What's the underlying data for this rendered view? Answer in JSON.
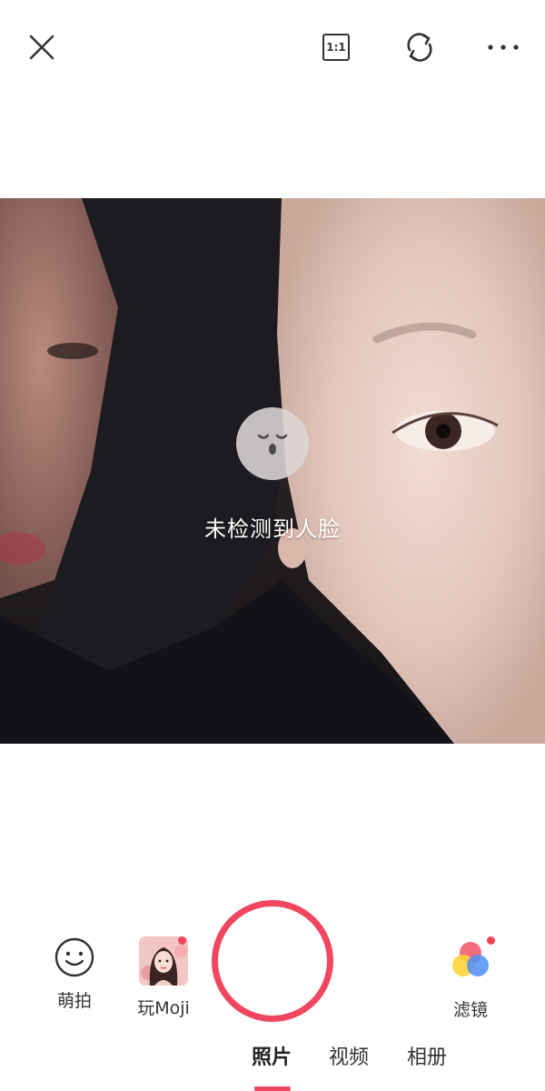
{
  "topbar": {
    "close_icon": "close-icon",
    "ratio_label": "1:1",
    "switch_icon": "switch-camera-icon",
    "more_icon": "more-icon"
  },
  "camera": {
    "face_status_text": "未检测到人脸",
    "face_status_icon": "sleepy-face-icon"
  },
  "tools": {
    "cute_label": "萌拍",
    "moji_label": "玩Moji",
    "filter_label": "滤镜"
  },
  "modes": {
    "photo": "照片",
    "video": "视频",
    "album": "相册",
    "selected": "照片"
  },
  "colors": {
    "accent": "#f0465f",
    "badge_dot": "#f1435b"
  }
}
